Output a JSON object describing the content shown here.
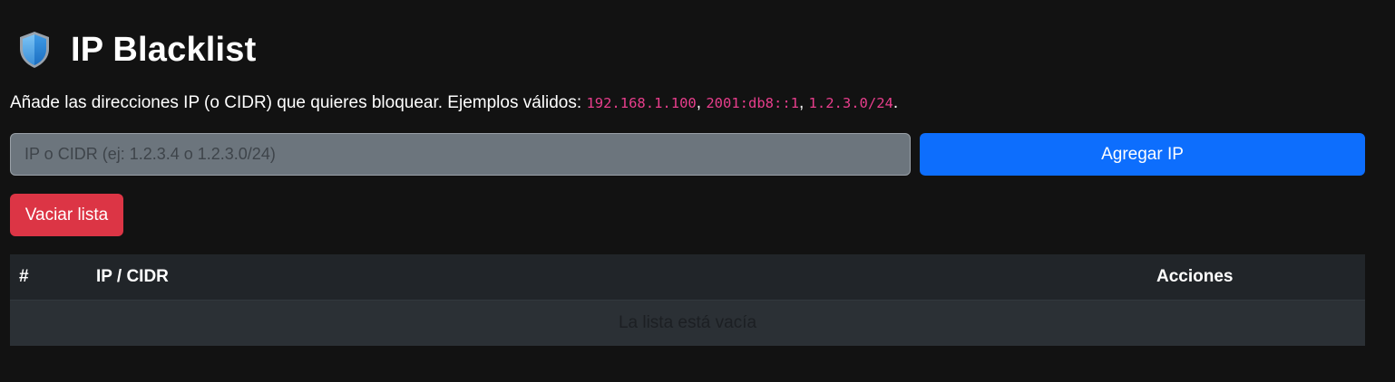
{
  "header": {
    "icon": "shield-icon",
    "title": "IP Blacklist"
  },
  "description": {
    "text": "Añade las direcciones IP (o CIDR) que quieres bloquear. Ejemplos válidos: ",
    "examples": [
      "192.168.1.100",
      "2001:db8::1",
      "1.2.3.0/24"
    ],
    "separator": ", ",
    "end": "."
  },
  "form": {
    "ip_value": "",
    "ip_placeholder": "IP o CIDR (ej: 1.2.3.4 o 1.2.3.0/24)",
    "add_label": "Agregar IP",
    "clear_label": "Vaciar lista"
  },
  "table": {
    "columns": [
      "#",
      "IP / CIDR",
      "Acciones"
    ],
    "rows": [],
    "empty_message": "La lista está vacía"
  },
  "colors": {
    "background": "#121212",
    "primary": "#0d6efd",
    "danger": "#dc3545",
    "code": "#e83e8c",
    "table_header": "#212529",
    "table_row": "#2b3035"
  }
}
